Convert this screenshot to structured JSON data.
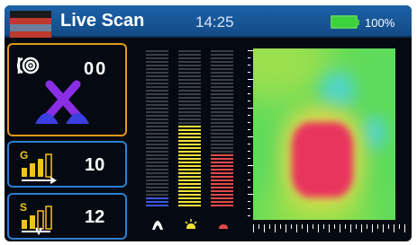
{
  "header": {
    "title": "Live Scan",
    "time": "14:25",
    "battery_percent": "100%",
    "battery_level": 1.0,
    "flag_colors": [
      "#1a1a1a",
      "#c0392b",
      "#6b7f9a",
      "#c0392b"
    ]
  },
  "panels": {
    "mode": {
      "icon": "target-sensor-icon",
      "value": "00",
      "probe_icon": "search-coil-icon"
    },
    "gain": {
      "icon": "gain-signal-icon",
      "letter": "G",
      "value": "10"
    },
    "sensitivity": {
      "icon": "sensitivity-signal-icon",
      "letter": "S",
      "value": "12"
    }
  },
  "level_bars": [
    {
      "name": "ground",
      "icon": "ground-icon",
      "color": "#3b55e0",
      "level": 0.06
    },
    {
      "name": "light",
      "icon": "lamp-icon",
      "color": "#f2e236",
      "level": 0.53
    },
    {
      "name": "mineral",
      "icon": "mineral-icon",
      "color": "#e24a4a",
      "level": 0.33
    }
  ],
  "colors": {
    "accent_orange": "#e09a1c",
    "accent_blue": "#2e7fd0",
    "header_blue": "#1d62a8",
    "heat_green": "#5fdb5b",
    "heat_red": "#e8355e",
    "heat_cyan": "#4fd4c8"
  }
}
